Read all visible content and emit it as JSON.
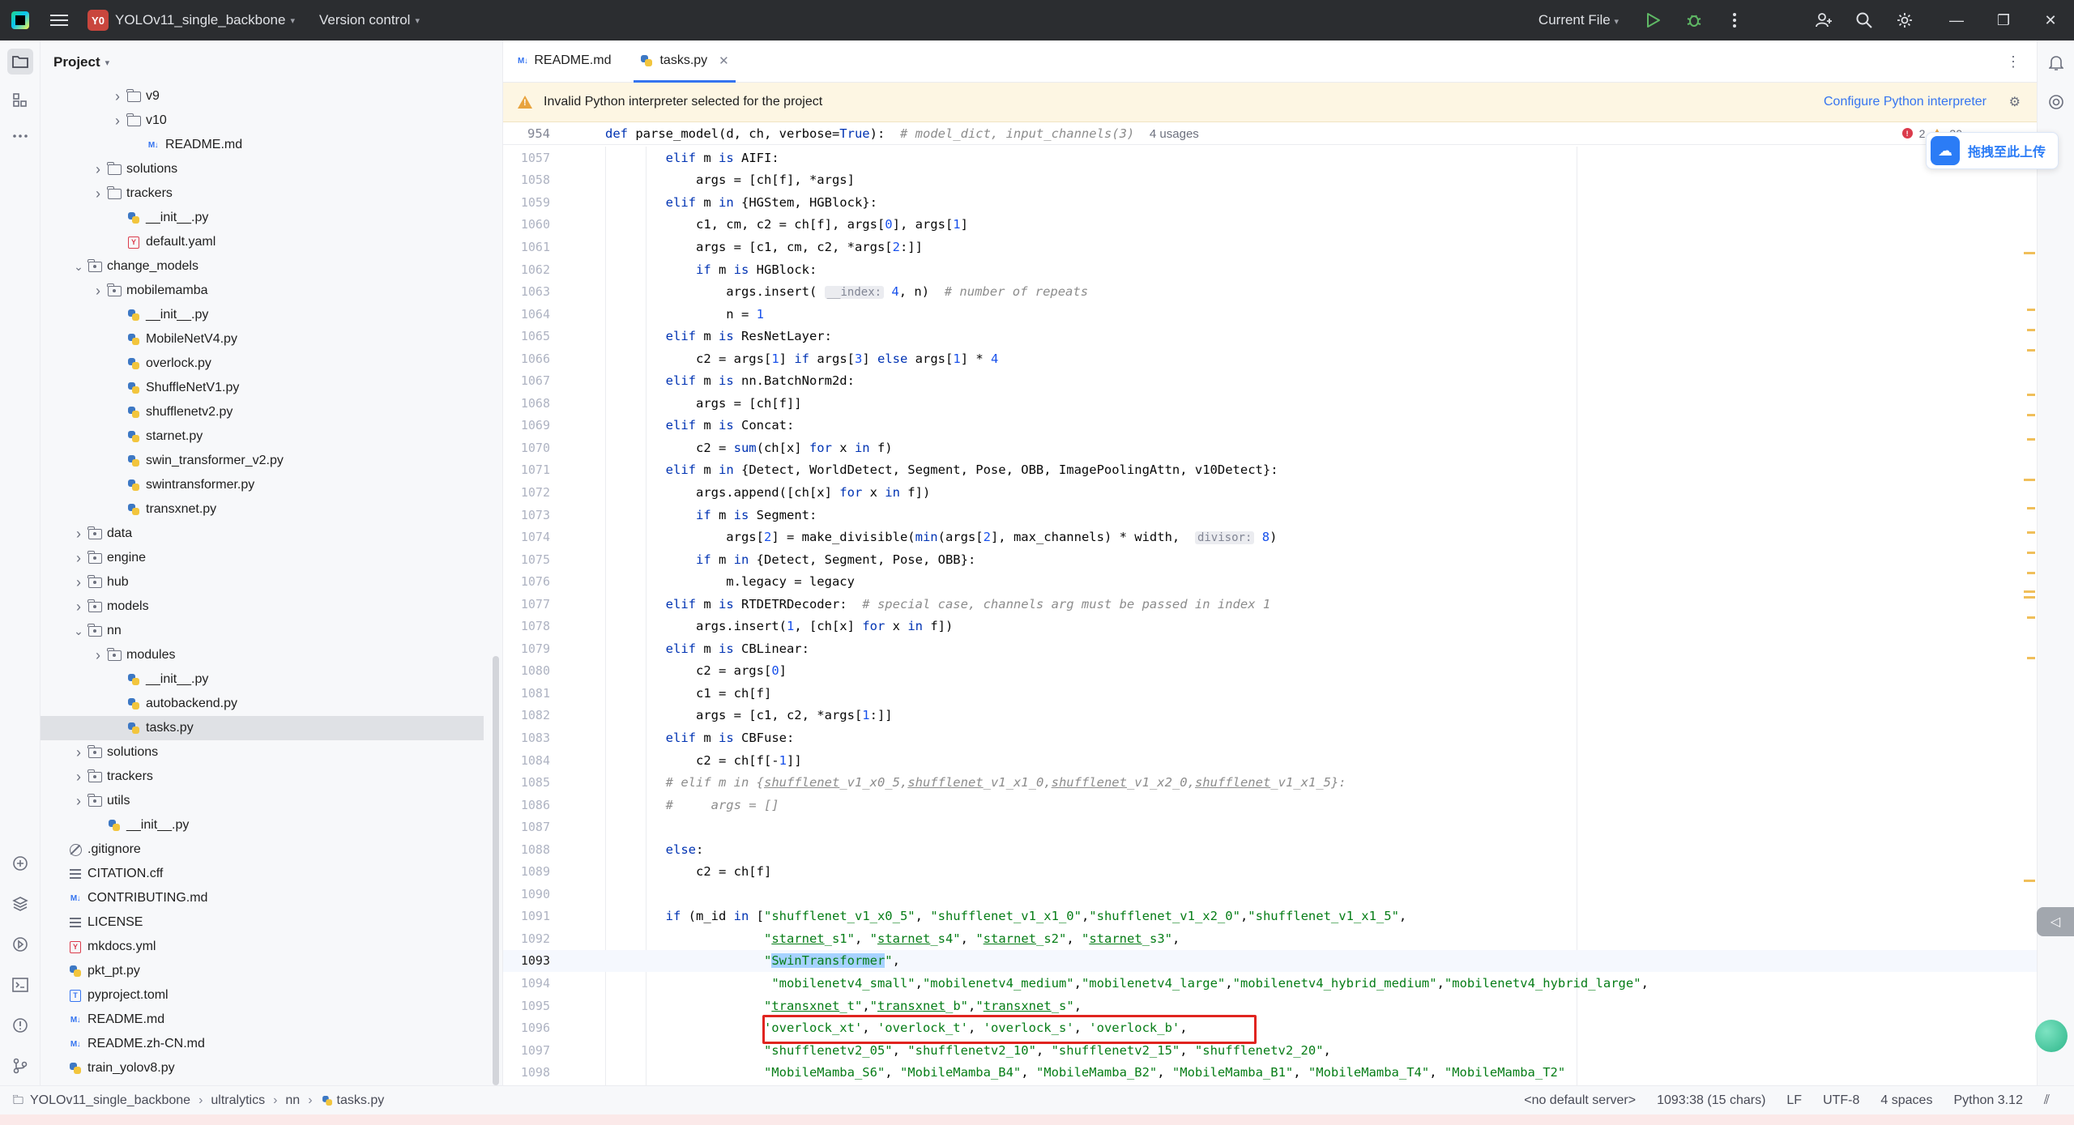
{
  "titlebar": {
    "project_badge": "Y0",
    "project_name": "YOLOv11_single_backbone",
    "vcs_label": "Version control",
    "run_config": "Current File"
  },
  "project_panel": {
    "title": "Project",
    "tree": [
      {
        "label": "v9",
        "type": "folder",
        "depth": 4,
        "expandable": true
      },
      {
        "label": "v10",
        "type": "folder",
        "depth": 4,
        "expandable": true
      },
      {
        "label": "README.md",
        "type": "md",
        "depth": 5
      },
      {
        "label": "solutions",
        "type": "folder",
        "depth": 3,
        "expandable": true
      },
      {
        "label": "trackers",
        "type": "folder",
        "depth": 3,
        "expandable": true
      },
      {
        "label": "__init__.py",
        "type": "py",
        "depth": 4
      },
      {
        "label": "default.yaml",
        "type": "yaml",
        "depth": 4
      },
      {
        "label": "change_models",
        "type": "package",
        "depth": 2,
        "expandable": true,
        "expanded": true
      },
      {
        "label": "mobilemamba",
        "type": "package",
        "depth": 3,
        "expandable": true
      },
      {
        "label": "__init__.py",
        "type": "py",
        "depth": 4
      },
      {
        "label": "MobileNetV4.py",
        "type": "py",
        "depth": 4
      },
      {
        "label": "overlock.py",
        "type": "py",
        "depth": 4
      },
      {
        "label": "ShuffleNetV1.py",
        "type": "py",
        "depth": 4
      },
      {
        "label": "shufflenetv2.py",
        "type": "py",
        "depth": 4
      },
      {
        "label": "starnet.py",
        "type": "py",
        "depth": 4
      },
      {
        "label": "swin_transformer_v2.py",
        "type": "py",
        "depth": 4
      },
      {
        "label": "swintransformer.py",
        "type": "py",
        "depth": 4
      },
      {
        "label": "transxnet.py",
        "type": "py",
        "depth": 4
      },
      {
        "label": "data",
        "type": "package",
        "depth": 2,
        "expandable": true
      },
      {
        "label": "engine",
        "type": "package",
        "depth": 2,
        "expandable": true
      },
      {
        "label": "hub",
        "type": "package",
        "depth": 2,
        "expandable": true
      },
      {
        "label": "models",
        "type": "package",
        "depth": 2,
        "expandable": true
      },
      {
        "label": "nn",
        "type": "package",
        "depth": 2,
        "expandable": true,
        "expanded": true
      },
      {
        "label": "modules",
        "type": "package",
        "depth": 3,
        "expandable": true
      },
      {
        "label": "__init__.py",
        "type": "py",
        "depth": 4
      },
      {
        "label": "autobackend.py",
        "type": "py",
        "depth": 4
      },
      {
        "label": "tasks.py",
        "type": "py",
        "depth": 4,
        "selected": true
      },
      {
        "label": "solutions",
        "type": "package",
        "depth": 2,
        "expandable": true
      },
      {
        "label": "trackers",
        "type": "package",
        "depth": 2,
        "expandable": true
      },
      {
        "label": "utils",
        "type": "package",
        "depth": 2,
        "expandable": true
      },
      {
        "label": "__init__.py",
        "type": "py",
        "depth": 3
      },
      {
        "label": ".gitignore",
        "type": "ignore",
        "depth": 1
      },
      {
        "label": "CITATION.cff",
        "type": "txt",
        "depth": 1
      },
      {
        "label": "CONTRIBUTING.md",
        "type": "md",
        "depth": 1
      },
      {
        "label": "LICENSE",
        "type": "txt",
        "depth": 1
      },
      {
        "label": "mkdocs.yml",
        "type": "yaml",
        "depth": 1
      },
      {
        "label": "pkt_pt.py",
        "type": "py",
        "depth": 1
      },
      {
        "label": "pyproject.toml",
        "type": "toml",
        "depth": 1
      },
      {
        "label": "README.md",
        "type": "md",
        "depth": 1
      },
      {
        "label": "README.zh-CN.md",
        "type": "md",
        "depth": 1
      },
      {
        "label": "train_yolov8.py",
        "type": "py",
        "depth": 1
      }
    ]
  },
  "editor": {
    "tabs": [
      {
        "label": "README.md",
        "icon": "markdown-icon",
        "active": false
      },
      {
        "label": "tasks.py",
        "icon": "python-icon",
        "active": true
      }
    ],
    "warning": {
      "text": "Invalid Python interpreter selected for the project",
      "link": "Configure Python interpreter"
    },
    "sticky": {
      "line": "954",
      "code_html": "<span class=\"kw\">def</span> parse_model(d, ch, verbose=<span class=\"kw\">True</span>):  <span class=\"cmt\"># model_dict, input_channels(3)</span>  <span style=\"font-family:'Liberation Sans',sans-serif;color:#6c707e;font-size:15px\">4 usages</span>"
    },
    "inspections": {
      "errors": "2",
      "warnings": "30"
    },
    "current_line": "1093",
    "lines": [
      {
        "n": "1057",
        "code": "        <span class=\"kw\">elif</span> m <span class=\"kw\">is</span> AIFI:"
      },
      {
        "n": "1058",
        "code": "            args = [ch[f], *args]"
      },
      {
        "n": "1059",
        "code": "        <span class=\"kw\">elif</span> m <span class=\"kw\">in</span> {HGStem, HGBlock}:"
      },
      {
        "n": "1060",
        "code": "            c1, cm, c2 = ch[f], args[<span class=\"num\">0</span>], args[<span class=\"num\">1</span>]"
      },
      {
        "n": "1061",
        "code": "            args = [c1, cm, c2, *args[<span class=\"num\">2</span>:]]"
      },
      {
        "n": "1062",
        "code": "            <span class=\"kw\">if</span> m <span class=\"kw\">is</span> HGBlock:"
      },
      {
        "n": "1063",
        "code": "                args.insert( <span class=\"hint\">__index:</span> <span class=\"num\">4</span>, n)  <span class=\"cmt\"># number of repeats</span>"
      },
      {
        "n": "1064",
        "code": "                n = <span class=\"num\">1</span>"
      },
      {
        "n": "1065",
        "code": "        <span class=\"kw\">elif</span> m <span class=\"kw\">is</span> ResNetLayer:"
      },
      {
        "n": "1066",
        "code": "            c2 = args[<span class=\"num\">1</span>] <span class=\"kw\">if</span> args[<span class=\"num\">3</span>] <span class=\"kw\">else</span> args[<span class=\"num\">1</span>] * <span class=\"num\">4</span>"
      },
      {
        "n": "1067",
        "code": "        <span class=\"kw\">elif</span> m <span class=\"kw\">is</span> nn.BatchNorm2d:"
      },
      {
        "n": "1068",
        "code": "            args = [ch[f]]"
      },
      {
        "n": "1069",
        "code": "        <span class=\"kw\">elif</span> m <span class=\"kw\">is</span> Concat:"
      },
      {
        "n": "1070",
        "code": "            c2 = <span class=\"kw\">sum</span>(ch[x] <span class=\"kw\">for</span> x <span class=\"kw\">in</span> f)"
      },
      {
        "n": "1071",
        "code": "        <span class=\"kw\">elif</span> m <span class=\"kw\">in</span> {Detect, WorldDetect, Segment, Pose, OBB, ImagePoolingAttn, v10Detect}:"
      },
      {
        "n": "1072",
        "code": "            args.append([ch[x] <span class=\"kw\">for</span> x <span class=\"kw\">in</span> f])"
      },
      {
        "n": "1073",
        "code": "            <span class=\"kw\">if</span> m <span class=\"kw\">is</span> Segment:"
      },
      {
        "n": "1074",
        "code": "                args[<span class=\"num\">2</span>] = make_divisible(<span class=\"kw\">min</span>(args[<span class=\"num\">2</span>], max_channels) * width,  <span class=\"hint\">divisor:</span> <span class=\"num\">8</span>)"
      },
      {
        "n": "1075",
        "code": "            <span class=\"kw\">if</span> m <span class=\"kw\">in</span> {Detect, Segment, Pose, OBB}:"
      },
      {
        "n": "1076",
        "code": "                m.legacy = legacy"
      },
      {
        "n": "1077",
        "code": "        <span class=\"kw\">elif</span> m <span class=\"kw\">is</span> RTDETRDecoder:  <span class=\"cmt\"># special case, channels arg must be passed in index 1</span>"
      },
      {
        "n": "1078",
        "code": "            args.insert(<span class=\"num\">1</span>, [ch[x] <span class=\"kw\">for</span> x <span class=\"kw\">in</span> f])"
      },
      {
        "n": "1079",
        "code": "        <span class=\"kw\">elif</span> m <span class=\"kw\">is</span> CBLinear:"
      },
      {
        "n": "1080",
        "code": "            c2 = args[<span class=\"num\">0</span>]"
      },
      {
        "n": "1081",
        "code": "            c1 = ch[f]"
      },
      {
        "n": "1082",
        "code": "            args = [c1, c2, *args[<span class=\"num\">1</span>:]]"
      },
      {
        "n": "1083",
        "code": "        <span class=\"kw\">elif</span> m <span class=\"kw\">is</span> CBFuse:"
      },
      {
        "n": "1084",
        "code": "            c2 = ch[f[-<span class=\"num\">1</span>]]"
      },
      {
        "n": "1085",
        "code": "        <span class=\"cmt\"># elif m in {<u>shufflenet</u>_v1_x0_5,<u>shufflenet</u>_v1_x1_0,<u>shufflenet</u>_v1_x2_0,<u>shufflenet</u>_v1_x1_5}:</span>"
      },
      {
        "n": "1086",
        "code": "        <span class=\"cmt\">#     args = []</span>"
      },
      {
        "n": "1087",
        "code": ""
      },
      {
        "n": "1088",
        "code": "        <span class=\"kw\">else</span>:"
      },
      {
        "n": "1089",
        "code": "            c2 = ch[f]"
      },
      {
        "n": "1090",
        "code": ""
      },
      {
        "n": "1091",
        "code": "        <span class=\"kw\">if</span> (m_id <span class=\"kw\">in</span> [<span class=\"str\">\"shufflenet_v1_x0_5\"</span>, <span class=\"str\">\"shufflenet_v1_x1_0\"</span>,<span class=\"str\">\"shufflenet_v1_x2_0\"</span>,<span class=\"str\">\"shufflenet_v1_x1_5\"</span>,"
      },
      {
        "n": "1092",
        "code": "                     <span class=\"str\">\"<u>starnet</u>_s1\"</span>, <span class=\"str\">\"<u>starnet</u>_s4\"</span>, <span class=\"str\">\"<u>starnet</u>_s2\"</span>, <span class=\"str\">\"<u>starnet</u>_s3\"</span>,"
      },
      {
        "n": "1093",
        "code": "                     <span class=\"str\">\"<span class=\"sel\">SwinTransformer</span>\"</span>,"
      },
      {
        "n": "1094",
        "code": "                      <span class=\"str\">\"mobilenetv4_small\"</span>,<span class=\"str\">\"mobilenetv4_medium\"</span>,<span class=\"str\">\"mobilenetv4_large\"</span>,<span class=\"str\">\"mobilenetv4_hybrid_medium\"</span>,<span class=\"str\">\"mobilenetv4_hybrid_large\"</span>,"
      },
      {
        "n": "1095",
        "code": "                     <span class=\"str\">\"<u>transxnet</u>_t\"</span>,<span class=\"str\">\"<u>transxnet</u>_b\"</span>,<span class=\"str\">\"<u>transxnet</u>_s\"</span>,"
      },
      {
        "n": "1096",
        "code": "                     <span class=\"str\">'overlock_xt'</span>, <span class=\"str\">'overlock_t'</span>, <span class=\"str\">'overlock_s'</span>, <span class=\"str\">'overlock_b'</span>,"
      },
      {
        "n": "1097",
        "code": "                     <span class=\"str\">\"shufflenetv2_05\"</span>, <span class=\"str\">\"shufflenetv2_10\"</span>, <span class=\"str\">\"shufflenetv2_15\"</span>, <span class=\"str\">\"shufflenetv2_20\"</span>,"
      },
      {
        "n": "1098",
        "code": "                     <span class=\"str\">\"MobileMamba_S6\"</span>, <span class=\"str\">\"MobileMamba_B4\"</span>, <span class=\"str\">\"MobileMamba_B2\"</span>, <span class=\"str\">\"MobileMamba_B1\"</span>, <span class=\"str\">\"MobileMamba_T4\"</span>, <span class=\"str\">\"MobileMamba_T2\"</span>"
      }
    ]
  },
  "upload_widget": {
    "label": "拖拽至此上传"
  },
  "statusbar": {
    "breadcrumb": [
      "YOLOv11_single_backbone",
      "ultralytics",
      "nn",
      "tasks.py"
    ],
    "server": "<no default server>",
    "position": "1093:38 (15 chars)",
    "line_sep": "LF",
    "encoding": "UTF-8",
    "indent": "4 spaces",
    "interpreter": "Python 3.12"
  },
  "colors": {
    "accent": "#3574f0",
    "keyword": "#0033b3",
    "string": "#067d17",
    "highlight_box": "#e0241f"
  }
}
